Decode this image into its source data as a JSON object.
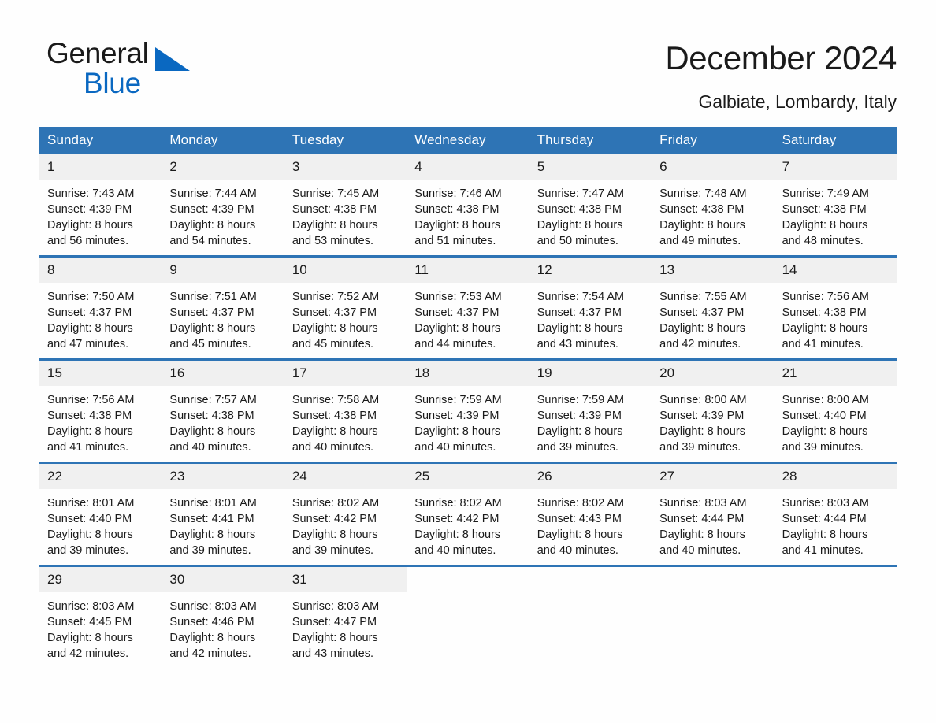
{
  "brand": {
    "name_part1": "General",
    "name_part2": "Blue",
    "logo_icon": "triangle-logo-icon",
    "accent_color": "#0a68c1"
  },
  "header": {
    "title": "December 2024",
    "subtitle": "Galbiate, Lombardy, Italy"
  },
  "calendar": {
    "header_bg": "#2e74b5",
    "daynum_bg": "#f0f0f0",
    "weekdays": [
      "Sunday",
      "Monday",
      "Tuesday",
      "Wednesday",
      "Thursday",
      "Friday",
      "Saturday"
    ],
    "weeks": [
      [
        {
          "day": "1",
          "sunrise": "Sunrise: 7:43 AM",
          "sunset": "Sunset: 4:39 PM",
          "daylight_line1": "Daylight: 8 hours",
          "daylight_line2": "and 56 minutes."
        },
        {
          "day": "2",
          "sunrise": "Sunrise: 7:44 AM",
          "sunset": "Sunset: 4:39 PM",
          "daylight_line1": "Daylight: 8 hours",
          "daylight_line2": "and 54 minutes."
        },
        {
          "day": "3",
          "sunrise": "Sunrise: 7:45 AM",
          "sunset": "Sunset: 4:38 PM",
          "daylight_line1": "Daylight: 8 hours",
          "daylight_line2": "and 53 minutes."
        },
        {
          "day": "4",
          "sunrise": "Sunrise: 7:46 AM",
          "sunset": "Sunset: 4:38 PM",
          "daylight_line1": "Daylight: 8 hours",
          "daylight_line2": "and 51 minutes."
        },
        {
          "day": "5",
          "sunrise": "Sunrise: 7:47 AM",
          "sunset": "Sunset: 4:38 PM",
          "daylight_line1": "Daylight: 8 hours",
          "daylight_line2": "and 50 minutes."
        },
        {
          "day": "6",
          "sunrise": "Sunrise: 7:48 AM",
          "sunset": "Sunset: 4:38 PM",
          "daylight_line1": "Daylight: 8 hours",
          "daylight_line2": "and 49 minutes."
        },
        {
          "day": "7",
          "sunrise": "Sunrise: 7:49 AM",
          "sunset": "Sunset: 4:38 PM",
          "daylight_line1": "Daylight: 8 hours",
          "daylight_line2": "and 48 minutes."
        }
      ],
      [
        {
          "day": "8",
          "sunrise": "Sunrise: 7:50 AM",
          "sunset": "Sunset: 4:37 PM",
          "daylight_line1": "Daylight: 8 hours",
          "daylight_line2": "and 47 minutes."
        },
        {
          "day": "9",
          "sunrise": "Sunrise: 7:51 AM",
          "sunset": "Sunset: 4:37 PM",
          "daylight_line1": "Daylight: 8 hours",
          "daylight_line2": "and 45 minutes."
        },
        {
          "day": "10",
          "sunrise": "Sunrise: 7:52 AM",
          "sunset": "Sunset: 4:37 PM",
          "daylight_line1": "Daylight: 8 hours",
          "daylight_line2": "and 45 minutes."
        },
        {
          "day": "11",
          "sunrise": "Sunrise: 7:53 AM",
          "sunset": "Sunset: 4:37 PM",
          "daylight_line1": "Daylight: 8 hours",
          "daylight_line2": "and 44 minutes."
        },
        {
          "day": "12",
          "sunrise": "Sunrise: 7:54 AM",
          "sunset": "Sunset: 4:37 PM",
          "daylight_line1": "Daylight: 8 hours",
          "daylight_line2": "and 43 minutes."
        },
        {
          "day": "13",
          "sunrise": "Sunrise: 7:55 AM",
          "sunset": "Sunset: 4:37 PM",
          "daylight_line1": "Daylight: 8 hours",
          "daylight_line2": "and 42 minutes."
        },
        {
          "day": "14",
          "sunrise": "Sunrise: 7:56 AM",
          "sunset": "Sunset: 4:38 PM",
          "daylight_line1": "Daylight: 8 hours",
          "daylight_line2": "and 41 minutes."
        }
      ],
      [
        {
          "day": "15",
          "sunrise": "Sunrise: 7:56 AM",
          "sunset": "Sunset: 4:38 PM",
          "daylight_line1": "Daylight: 8 hours",
          "daylight_line2": "and 41 minutes."
        },
        {
          "day": "16",
          "sunrise": "Sunrise: 7:57 AM",
          "sunset": "Sunset: 4:38 PM",
          "daylight_line1": "Daylight: 8 hours",
          "daylight_line2": "and 40 minutes."
        },
        {
          "day": "17",
          "sunrise": "Sunrise: 7:58 AM",
          "sunset": "Sunset: 4:38 PM",
          "daylight_line1": "Daylight: 8 hours",
          "daylight_line2": "and 40 minutes."
        },
        {
          "day": "18",
          "sunrise": "Sunrise: 7:59 AM",
          "sunset": "Sunset: 4:39 PM",
          "daylight_line1": "Daylight: 8 hours",
          "daylight_line2": "and 40 minutes."
        },
        {
          "day": "19",
          "sunrise": "Sunrise: 7:59 AM",
          "sunset": "Sunset: 4:39 PM",
          "daylight_line1": "Daylight: 8 hours",
          "daylight_line2": "and 39 minutes."
        },
        {
          "day": "20",
          "sunrise": "Sunrise: 8:00 AM",
          "sunset": "Sunset: 4:39 PM",
          "daylight_line1": "Daylight: 8 hours",
          "daylight_line2": "and 39 minutes."
        },
        {
          "day": "21",
          "sunrise": "Sunrise: 8:00 AM",
          "sunset": "Sunset: 4:40 PM",
          "daylight_line1": "Daylight: 8 hours",
          "daylight_line2": "and 39 minutes."
        }
      ],
      [
        {
          "day": "22",
          "sunrise": "Sunrise: 8:01 AM",
          "sunset": "Sunset: 4:40 PM",
          "daylight_line1": "Daylight: 8 hours",
          "daylight_line2": "and 39 minutes."
        },
        {
          "day": "23",
          "sunrise": "Sunrise: 8:01 AM",
          "sunset": "Sunset: 4:41 PM",
          "daylight_line1": "Daylight: 8 hours",
          "daylight_line2": "and 39 minutes."
        },
        {
          "day": "24",
          "sunrise": "Sunrise: 8:02 AM",
          "sunset": "Sunset: 4:42 PM",
          "daylight_line1": "Daylight: 8 hours",
          "daylight_line2": "and 39 minutes."
        },
        {
          "day": "25",
          "sunrise": "Sunrise: 8:02 AM",
          "sunset": "Sunset: 4:42 PM",
          "daylight_line1": "Daylight: 8 hours",
          "daylight_line2": "and 40 minutes."
        },
        {
          "day": "26",
          "sunrise": "Sunrise: 8:02 AM",
          "sunset": "Sunset: 4:43 PM",
          "daylight_line1": "Daylight: 8 hours",
          "daylight_line2": "and 40 minutes."
        },
        {
          "day": "27",
          "sunrise": "Sunrise: 8:03 AM",
          "sunset": "Sunset: 4:44 PM",
          "daylight_line1": "Daylight: 8 hours",
          "daylight_line2": "and 40 minutes."
        },
        {
          "day": "28",
          "sunrise": "Sunrise: 8:03 AM",
          "sunset": "Sunset: 4:44 PM",
          "daylight_line1": "Daylight: 8 hours",
          "daylight_line2": "and 41 minutes."
        }
      ],
      [
        {
          "day": "29",
          "sunrise": "Sunrise: 8:03 AM",
          "sunset": "Sunset: 4:45 PM",
          "daylight_line1": "Daylight: 8 hours",
          "daylight_line2": "and 42 minutes."
        },
        {
          "day": "30",
          "sunrise": "Sunrise: 8:03 AM",
          "sunset": "Sunset: 4:46 PM",
          "daylight_line1": "Daylight: 8 hours",
          "daylight_line2": "and 42 minutes."
        },
        {
          "day": "31",
          "sunrise": "Sunrise: 8:03 AM",
          "sunset": "Sunset: 4:47 PM",
          "daylight_line1": "Daylight: 8 hours",
          "daylight_line2": "and 43 minutes."
        },
        {
          "day": "",
          "sunrise": "",
          "sunset": "",
          "daylight_line1": "",
          "daylight_line2": ""
        },
        {
          "day": "",
          "sunrise": "",
          "sunset": "",
          "daylight_line1": "",
          "daylight_line2": ""
        },
        {
          "day": "",
          "sunrise": "",
          "sunset": "",
          "daylight_line1": "",
          "daylight_line2": ""
        },
        {
          "day": "",
          "sunrise": "",
          "sunset": "",
          "daylight_line1": "",
          "daylight_line2": ""
        }
      ]
    ]
  }
}
